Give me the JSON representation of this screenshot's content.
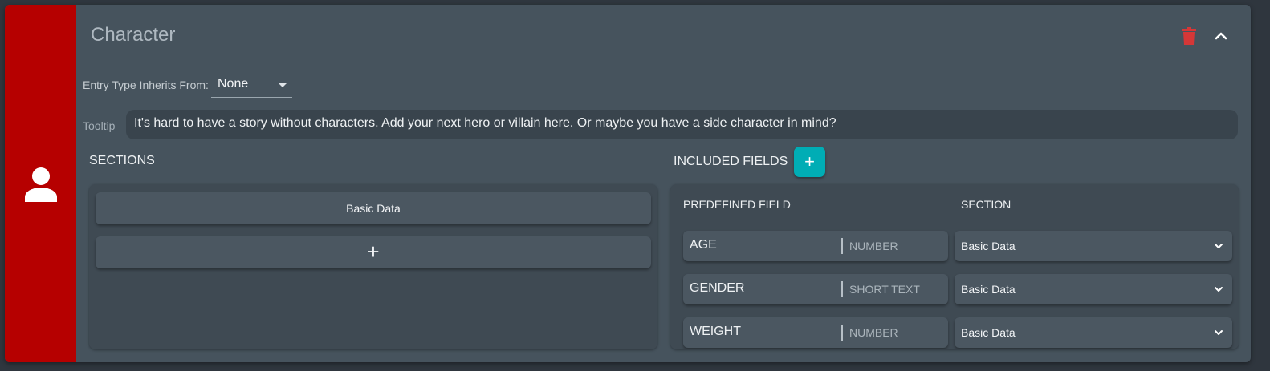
{
  "entry": {
    "title": "Character",
    "accent_color": "#b60000",
    "icon": "person-icon",
    "delete_icon": "trash-icon",
    "collapse_icon": "chevron-up-icon"
  },
  "inherits": {
    "label": "Entry Type Inherits From:",
    "value": "None"
  },
  "tooltip": {
    "label": "Tooltip",
    "value": "It's hard to have a story without characters. Add your next hero or villain here. Or maybe you have a side character in mind?"
  },
  "sections": {
    "heading": "SECTIONS",
    "items": [
      "Basic Data"
    ],
    "add_label": "+"
  },
  "fields": {
    "heading": "INCLUDED FIELDS",
    "add_label": "+",
    "add_color": "#00adb5",
    "col_field": "PREDEFINED FIELD",
    "col_section": "SECTION",
    "rows": [
      {
        "name": "AGE",
        "type": "NUMBER",
        "section": "Basic Data"
      },
      {
        "name": "GENDER",
        "type": "SHORT TEXT",
        "section": "Basic Data"
      },
      {
        "name": "WEIGHT",
        "type": "NUMBER",
        "section": "Basic Data"
      }
    ]
  }
}
